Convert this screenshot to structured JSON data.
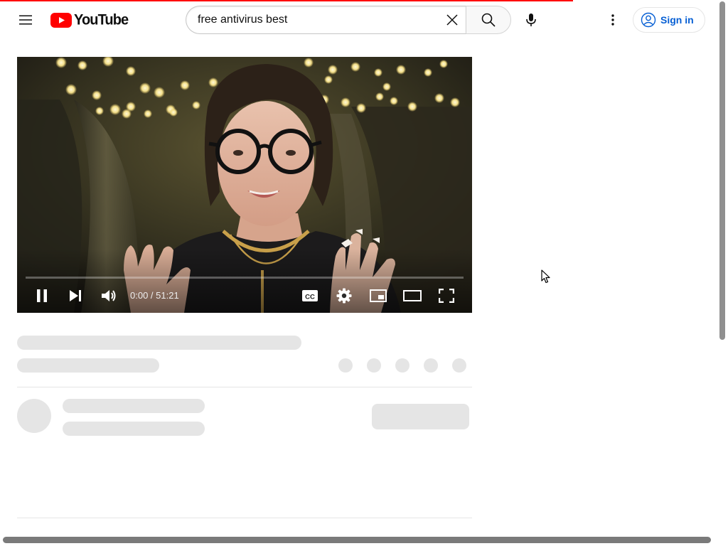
{
  "app": {
    "logo_text": "YouTube"
  },
  "search": {
    "query": "free antivirus best",
    "placeholder": "Search"
  },
  "header": {
    "signin_label": "Sign in"
  },
  "player": {
    "time_display": "0:00 / 51:21",
    "progress_fraction": 0
  },
  "icons": {
    "menu": "hamburger-menu-icon",
    "clear": "close-icon",
    "search": "search-icon",
    "mic": "microphone-icon",
    "more": "more-vert-icon",
    "account": "account-circle-icon",
    "pause": "pause-icon",
    "next": "next-icon",
    "volume": "volume-icon",
    "captions": "cc-icon",
    "settings": "gear-icon",
    "miniplayer": "miniplayer-icon",
    "theater": "theater-mode-icon",
    "fullscreen": "fullscreen-icon"
  },
  "colors": {
    "brand_red": "#ff0000",
    "link_blue": "#065fd4",
    "skeleton": "#e5e5e5"
  }
}
